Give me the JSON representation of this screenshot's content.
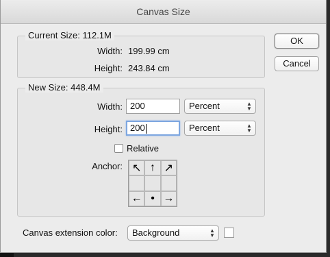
{
  "dialog": {
    "title": "Canvas Size"
  },
  "current_size": {
    "legend": "Current Size: 112.1M",
    "width_label": "Width:",
    "width_value": "199.99 cm",
    "height_label": "Height:",
    "height_value": "243.84 cm"
  },
  "new_size": {
    "legend": "New Size: 448.4M",
    "width_label": "Width:",
    "width_value": "200",
    "width_unit": "Percent",
    "height_label": "Height:",
    "height_value": "200",
    "height_unit": "Percent",
    "relative_label": "Relative",
    "relative_checked": false,
    "anchor_label": "Anchor:"
  },
  "anchor": {
    "cells": [
      "↖",
      "↑",
      "↗",
      "",
      "",
      "",
      "←",
      "•",
      "→"
    ]
  },
  "buttons": {
    "ok": "OK",
    "cancel": "Cancel"
  },
  "extension": {
    "label": "Canvas extension color:",
    "value": "Background",
    "swatch_color": "#ffffff"
  },
  "icons": {
    "select_arrows": "⬍"
  }
}
